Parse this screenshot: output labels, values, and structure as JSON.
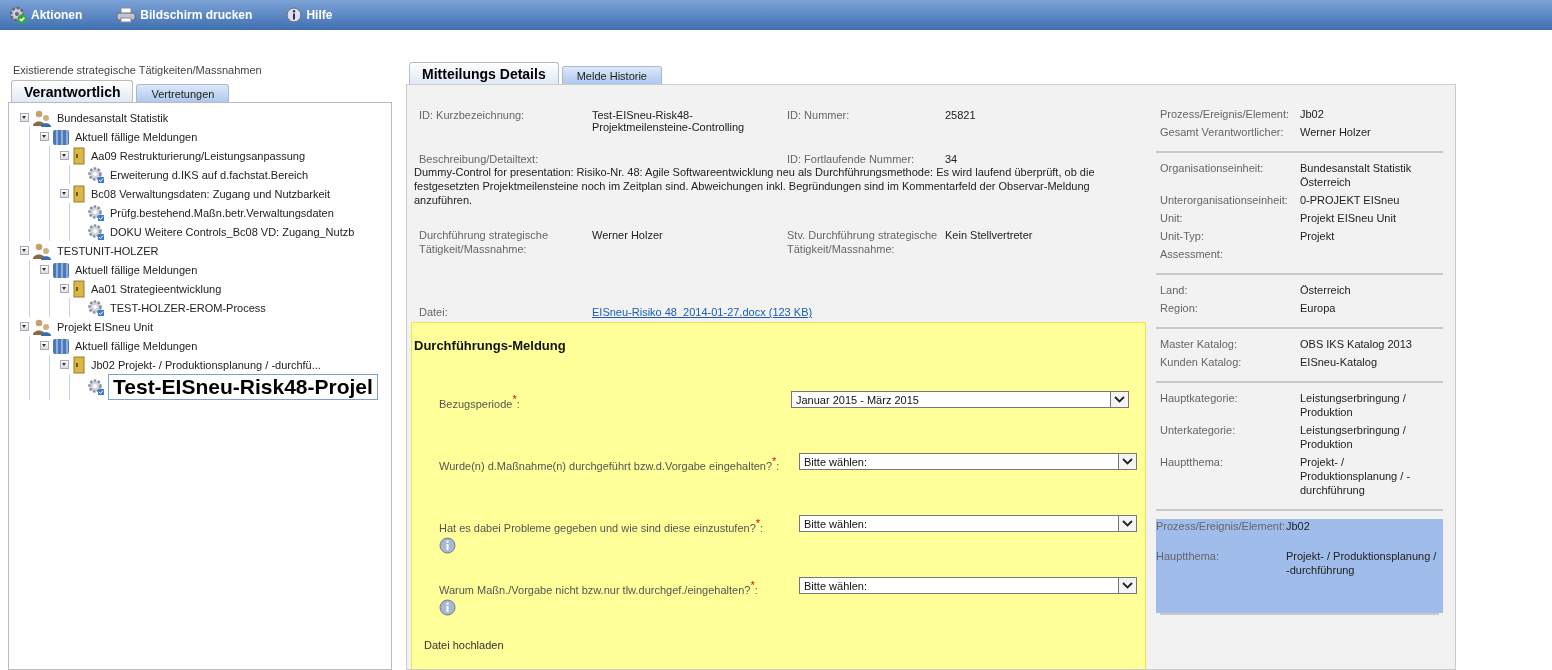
{
  "toolbar": {
    "items": [
      {
        "label": "Aktionen",
        "kind": "actions"
      },
      {
        "label": "Bildschirm drucken",
        "kind": "print"
      },
      {
        "label": "Hilfe",
        "kind": "help"
      }
    ]
  },
  "left_panel": {
    "title": "Existierende strategische Tätigkeiten/Massnahmen",
    "tabs": [
      {
        "label": "Verantwortlich",
        "selected": true
      },
      {
        "label": "Vertretungen",
        "selected": false
      }
    ],
    "tree": [
      {
        "label": "Bundesanstalt Statistik",
        "kind": "unit",
        "expanded": true,
        "selected": false,
        "children": [
          {
            "label": "Aktuell fällige Meldungen",
            "kind": "group",
            "expanded": true,
            "selected": false,
            "children": [
              {
                "label": "Aa09 Restrukturierung/Leistungsanpassung",
                "kind": "folder",
                "expanded": true,
                "selected": false,
                "children": [
                  {
                    "label": "Erweiterung d.IKS auf d.fachstat.Bereich",
                    "kind": "control",
                    "selected": false
                  }
                ]
              },
              {
                "label": "Bc08 Verwaltungsdaten: Zugang und Nutzbarkeit",
                "kind": "folder",
                "expanded": true,
                "selected": false,
                "children": [
                  {
                    "label": "Prüfg.bestehend.Maßn.betr.Verwaltungsdaten",
                    "kind": "control",
                    "selected": false
                  },
                  {
                    "label": "DOKU Weitere Controls_Bc08 VD: Zugang_Nutzb",
                    "kind": "control",
                    "selected": false
                  }
                ]
              }
            ]
          }
        ]
      },
      {
        "label": "TESTUNIT-HOLZER",
        "kind": "unit",
        "expanded": true,
        "selected": false,
        "children": [
          {
            "label": "Aktuell fällige Meldungen",
            "kind": "group",
            "expanded": true,
            "selected": false,
            "children": [
              {
                "label": "Aa01 Strategieentwicklung",
                "kind": "folder",
                "expanded": true,
                "selected": false,
                "children": [
                  {
                    "label": "TEST-HOLZER-EROM-Process",
                    "kind": "control",
                    "selected": false
                  }
                ]
              }
            ]
          }
        ]
      },
      {
        "label": "Projekt EISneu Unit",
        "kind": "unit",
        "expanded": true,
        "selected": false,
        "children": [
          {
            "label": "Aktuell fällige Meldungen",
            "kind": "group",
            "expanded": true,
            "selected": false,
            "children": [
              {
                "label": "Jb02 Projekt- / Produktionsplanung / -durchfü...",
                "kind": "folder",
                "expanded": true,
                "selected": false,
                "children": [
                  {
                    "label": "Test-EISneu-Risk48-Projel",
                    "kind": "control",
                    "selected": true
                  }
                ]
              }
            ]
          }
        ]
      }
    ]
  },
  "detail": {
    "tabs": [
      {
        "label": "Mitteilungs Details",
        "selected": true
      },
      {
        "label": "Melde Historie",
        "selected": false
      }
    ],
    "fields": [
      {
        "label": "ID: Kurzbezeichnung:",
        "value": "Test-EISneu-Risk48-Projektmeilensteine-Controlling"
      },
      {
        "label": "ID: Nummer:",
        "value": "25821"
      },
      {
        "label": "Beschreibung/Detailtext:"
      },
      {
        "label": "ID: Fortlaufende Nummer:",
        "value": "34"
      }
    ],
    "description": "Dummy-Control for presentation: Risiko-Nr. 48: Agile Softwareentwicklung neu als Durchführungsmethode: Es wird laufend überprüft, ob die festgesetzten Projektmeilensteine noch im Zeitplan sind. Abweichungen inkl. Begründungen sind im Kommentarfeld der Observar-Meldung anzuführen.",
    "fields2": [
      {
        "label": "Durchführung strategische Tätigkeit/Massnahme:",
        "value": "Werner Holzer"
      },
      {
        "label": "Stv. Durchführung strategische Tätigkeit/Massnahme:",
        "value": "Kein Stellvertreter"
      }
    ],
    "file": {
      "label": "Datei:",
      "link": "EISneu-Risiko 48_2014-01-27.docx (123 KB)"
    },
    "form": {
      "title": "Durchführungs-Meldung",
      "fields": [
        {
          "label": "Bezugsperiode$^{*}$:",
          "info": false,
          "value": "Januar 2015 - März 2015"
        },
        {
          "label": "Wurde(n) d.Maßnahme(n) durchgeführt bzw.d.Vorgabe eingehalten?$^{*}$:",
          "info": false,
          "value": "Bitte wählen:"
        },
        {
          "label": "Hat es dabei Probleme gegeben und wie sind diese einzustufen?$^{*}$:",
          "info": true,
          "value": "Bitte wählen:"
        },
        {
          "label": "Warum Maßn./Vorgabe nicht bzw.nur tlw.durchgef./eingehalten?$^{*}$:",
          "info": true,
          "value": "Bitte wählen:"
        }
      ],
      "upload_label": "Datei hochladen"
    },
    "sections": [
      {
        "highlighted": false,
        "rows": [
          {
            "label": "Prozess/Ereignis/Element:",
            "value": "Jb02"
          },
          {
            "label": "Gesamt Verantwortlicher:",
            "value": "Werner Holzer"
          }
        ]
      },
      {
        "highlighted": false,
        "rows": [
          {
            "label": "Organisationseinheit:",
            "value": "Bundesanstalt Statistik Österreich"
          },
          {
            "label": "Unterorganisationseinheit:",
            "value": "0-PROJEKT EISneu"
          },
          {
            "label": "Unit:",
            "value": "Projekt EISneu Unit"
          },
          {
            "label": "Unit-Typ:",
            "value": "Projekt"
          },
          {
            "label": "Assessment:"
          }
        ]
      },
      {
        "highlighted": false,
        "rows": [
          {
            "label": "Land:",
            "value": "Österreich"
          },
          {
            "label": "Region:",
            "value": "Europa"
          }
        ]
      },
      {
        "highlighted": false,
        "rows": [
          {
            "label": "Master Katalog:",
            "value": "OBS IKS Katalog 2013"
          },
          {
            "label": "Kunden Katalog:",
            "value": "EISneu-Katalog"
          }
        ]
      },
      {
        "highlighted": false,
        "rows": [
          {
            "label": "Hauptkategorie:",
            "value": "Leistungserbringung / Produktion"
          },
          {
            "label": "Unterkategorie:",
            "value": "Leistungserbringung / Produktion"
          },
          {
            "label": "Hauptthema:",
            "value": "Projekt- / Produktionsplanung / -durchführung"
          }
        ]
      },
      {
        "highlighted": true,
        "rows": [
          {
            "label": "Prozess/Ereignis/Element:",
            "value": "Jb02"
          },
          {
            "label": "Hauptthema:",
            "value": "Projekt- / Produktionsplanung / -durchführung"
          }
        ]
      }
    ]
  }
}
